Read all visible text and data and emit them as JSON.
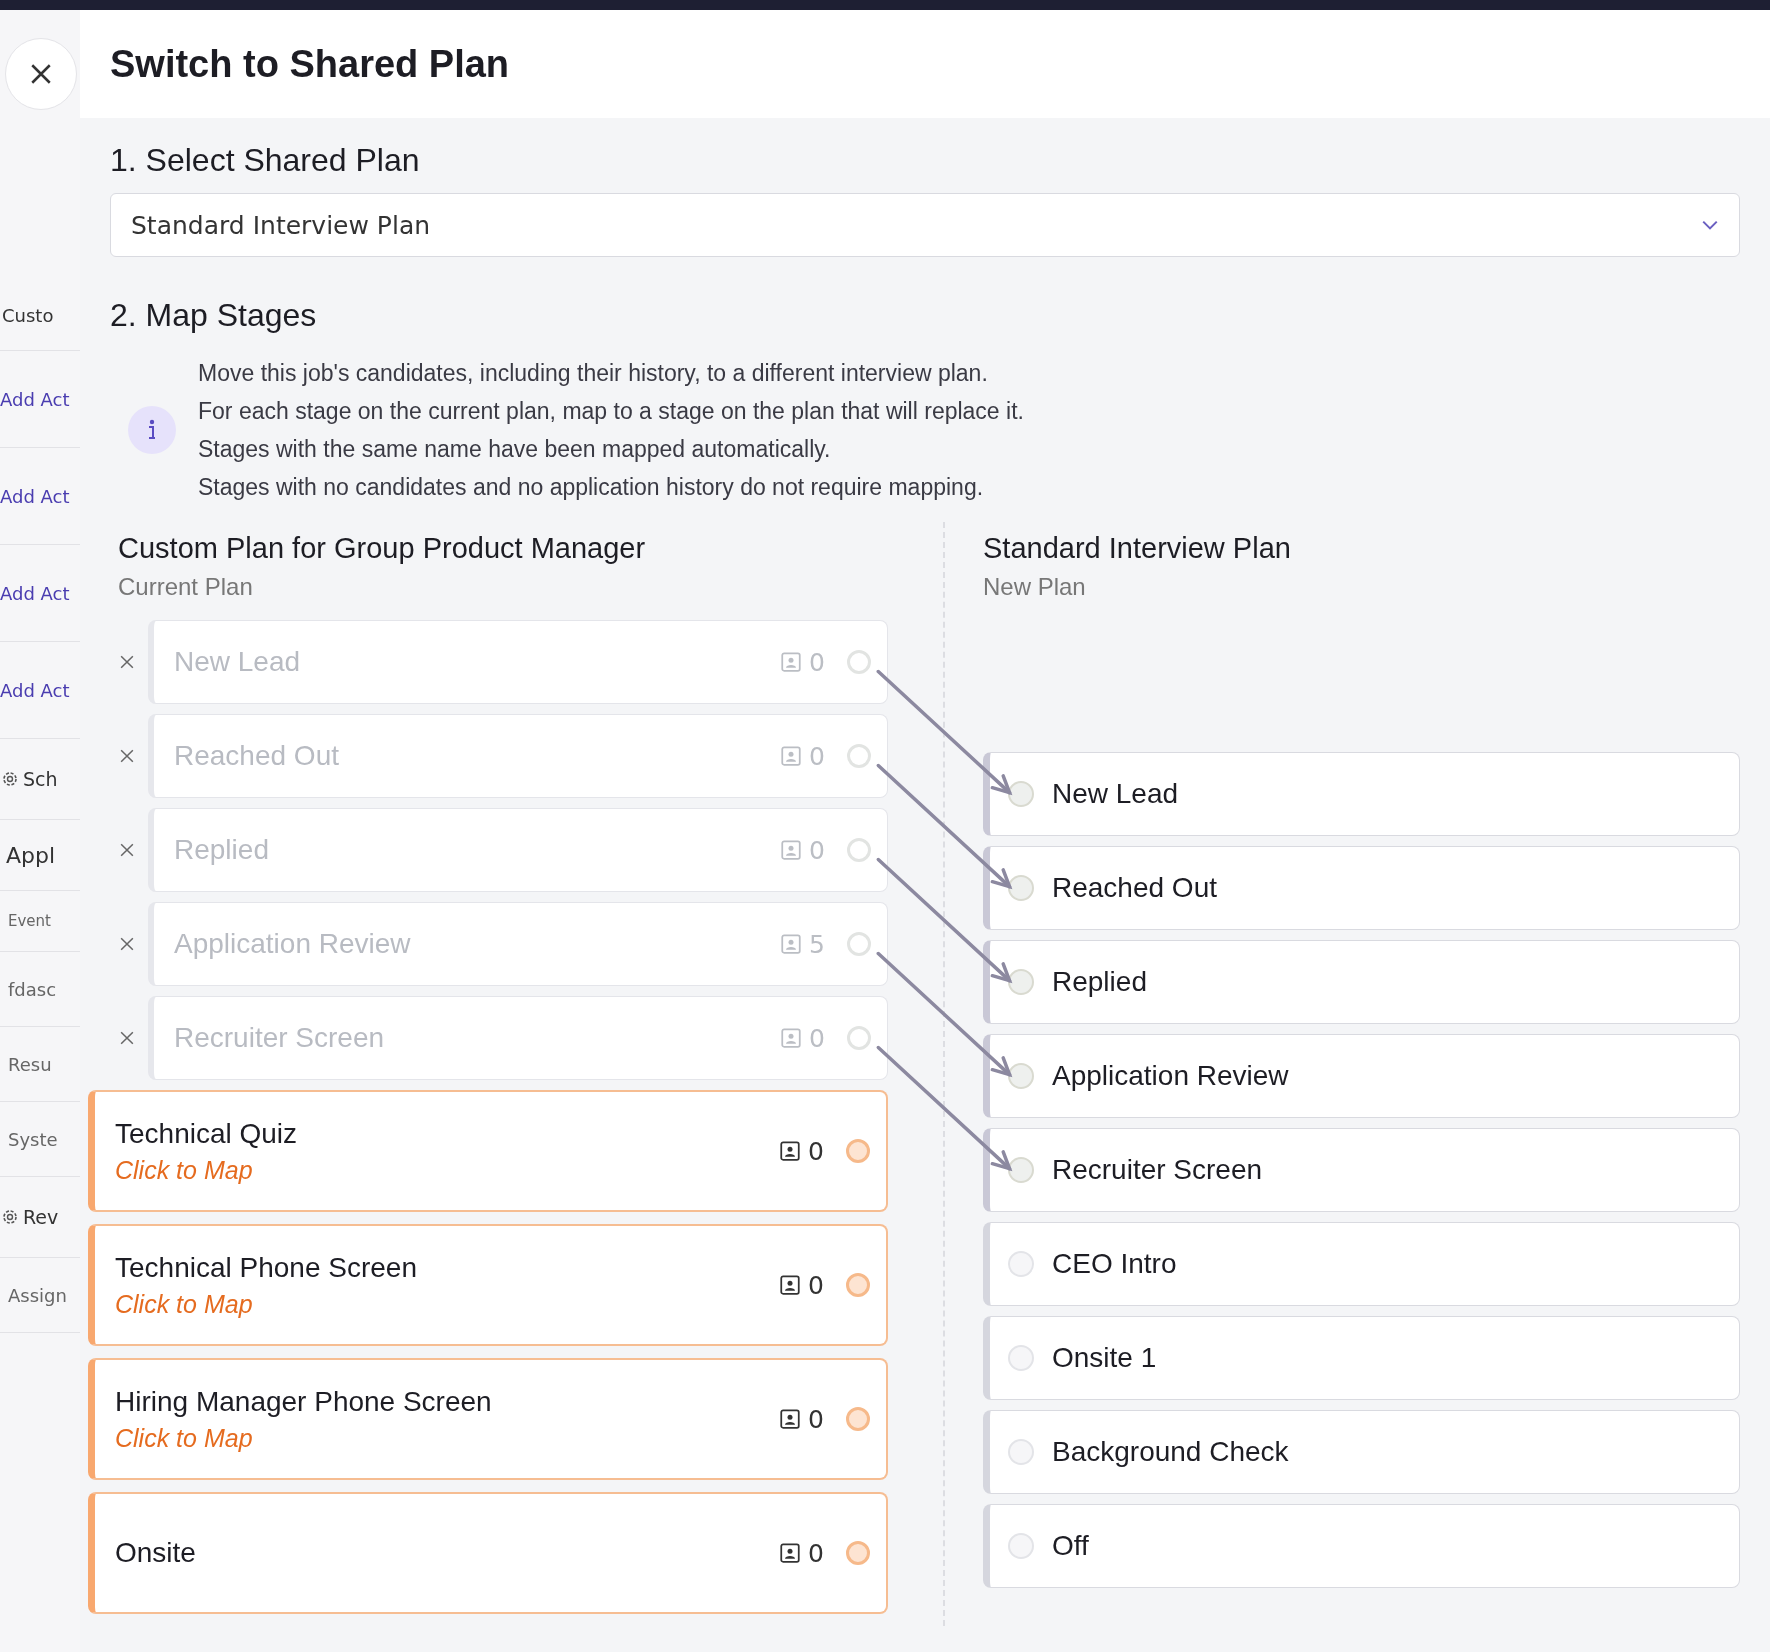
{
  "background_page": {
    "items": [
      {
        "kind": "tab",
        "text": "Custo"
      },
      {
        "kind": "link",
        "text": "Add Act"
      },
      {
        "kind": "link",
        "text": "Add Act"
      },
      {
        "kind": "link",
        "text": "Add Act"
      },
      {
        "kind": "link",
        "text": "Add Act"
      },
      {
        "kind": "gear",
        "text": "Sch"
      },
      {
        "kind": "heading",
        "text": "Appl"
      },
      {
        "kind": "column",
        "text": "Event"
      },
      {
        "kind": "row",
        "text": "fdasc"
      },
      {
        "kind": "row",
        "text": "Resu"
      },
      {
        "kind": "row",
        "text": "Syste"
      },
      {
        "kind": "gear",
        "text": "Rev"
      },
      {
        "kind": "row",
        "text": "Assign"
      }
    ]
  },
  "modal": {
    "title": "Switch to Shared Plan",
    "step_1": {
      "title": "1. Select Shared Plan",
      "select": {
        "value": "Standard Interview Plan"
      }
    },
    "step_2": {
      "title": "2. Map Stages",
      "info": [
        "Move this job's candidates, including their history, to a different interview plan.",
        "For each stage on the current plan, map to a stage on the plan that will replace it.",
        "Stages with the same name have been mapped automatically.",
        "Stages with no candidates and no application history do not require mapping."
      ],
      "current_plan": {
        "title": "Custom Plan for Group Product Manager",
        "subtitle": "Current Plan",
        "stages": [
          {
            "name": "New Lead",
            "count": "0",
            "mapped": true
          },
          {
            "name": "Reached Out",
            "count": "0",
            "mapped": true
          },
          {
            "name": "Replied",
            "count": "0",
            "mapped": true
          },
          {
            "name": "Application Review",
            "count": "5",
            "mapped": true
          },
          {
            "name": "Recruiter Screen",
            "count": "0",
            "mapped": true
          },
          {
            "name": "Technical Quiz",
            "count": "0",
            "mapped": false,
            "action": "Click to Map"
          },
          {
            "name": "Technical Phone Screen",
            "count": "0",
            "mapped": false,
            "action": "Click to Map"
          },
          {
            "name": "Hiring Manager Phone Screen",
            "count": "0",
            "mapped": false,
            "action": "Click to Map"
          },
          {
            "name": "Onsite",
            "count": "0",
            "mapped": false
          }
        ]
      },
      "new_plan": {
        "title": "Standard Interview Plan",
        "subtitle": "New Plan",
        "stages": [
          {
            "name": "New Lead",
            "mapped": true
          },
          {
            "name": "Reached Out",
            "mapped": true
          },
          {
            "name": "Replied",
            "mapped": true
          },
          {
            "name": "Application Review",
            "mapped": true
          },
          {
            "name": "Recruiter Screen",
            "mapped": true
          },
          {
            "name": "CEO Intro",
            "mapped": false
          },
          {
            "name": "Onsite 1",
            "mapped": false
          },
          {
            "name": "Background Check",
            "mapped": false
          },
          {
            "name": "Off",
            "mapped": false
          }
        ]
      }
    }
  }
}
